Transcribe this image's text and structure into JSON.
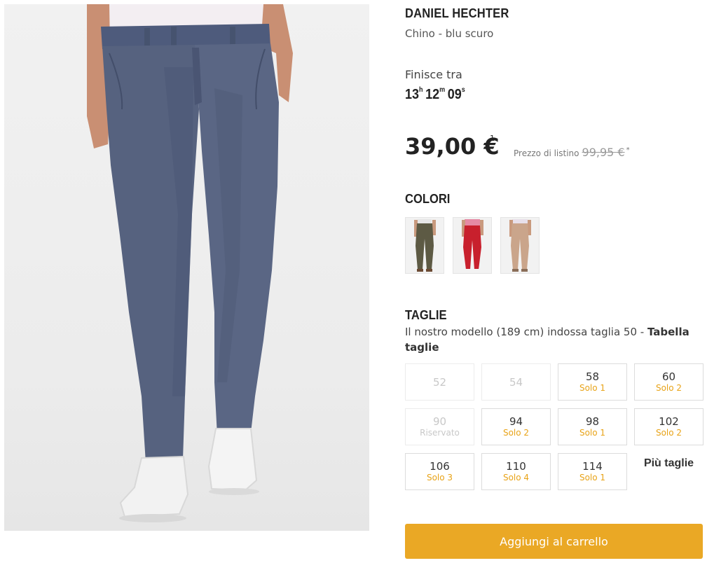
{
  "product": {
    "brand": "DANIEL HECHTER",
    "subtitle": "Chino - blu scuro"
  },
  "timer": {
    "label": "Finisce tra",
    "hours": "13",
    "hours_unit": "h",
    "minutes": "12",
    "minutes_unit": "m",
    "seconds": "09",
    "seconds_unit": "s"
  },
  "pricing": {
    "price": "39,00 €",
    "price_note": "1",
    "list_label": "Prezzo di listino",
    "list_price": "99,95 €",
    "list_note": "*"
  },
  "colors": {
    "title": "COLORI",
    "swatches": [
      {
        "name": "olive",
        "color": "#5d5a44"
      },
      {
        "name": "red",
        "color": "#c8202d"
      },
      {
        "name": "beige",
        "color": "#caa58b"
      }
    ]
  },
  "sizes": {
    "title": "TAGLIE",
    "model_note": "Il nostro modello (189 cm) indossa taglia 50 - ",
    "size_chart_link": "Tabella taglie",
    "items": [
      {
        "size": "52",
        "stock": ""
      },
      {
        "size": "54",
        "stock": ""
      },
      {
        "size": "58",
        "stock": "Solo 1"
      },
      {
        "size": "60",
        "stock": "Solo 2"
      },
      {
        "size": "90",
        "stock": "Riservato"
      },
      {
        "size": "94",
        "stock": "Solo 2"
      },
      {
        "size": "98",
        "stock": "Solo 1"
      },
      {
        "size": "102",
        "stock": "Solo 2"
      },
      {
        "size": "106",
        "stock": "Solo 3"
      },
      {
        "size": "110",
        "stock": "Solo 4"
      },
      {
        "size": "114",
        "stock": "Solo 1"
      }
    ],
    "more_label": "Più taglie"
  },
  "cart": {
    "button_label": "Aggiungi al carrello",
    "accent": "#eaa825"
  }
}
